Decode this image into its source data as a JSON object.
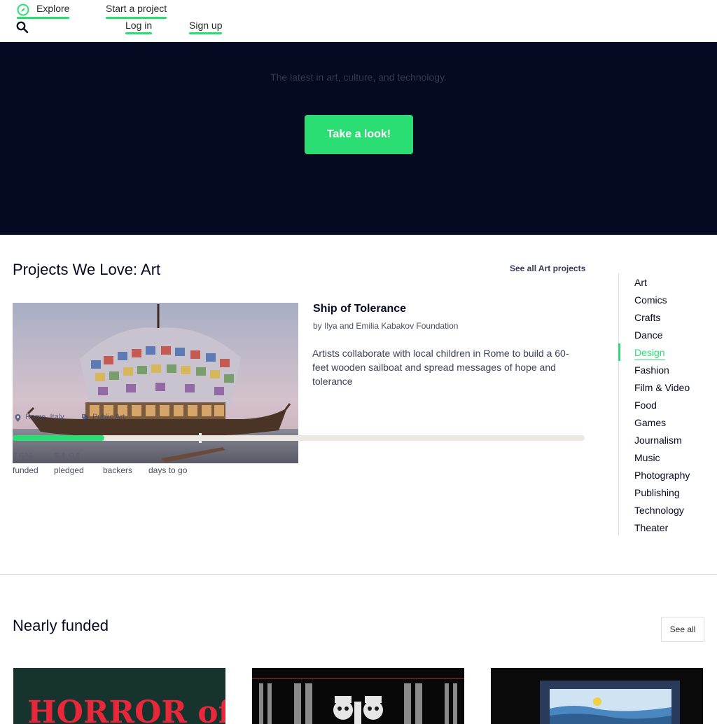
{
  "nav": {
    "explore": "Explore",
    "start_project": "Start a project",
    "log_in": "Log in",
    "sign_up": "Sign up",
    "search_icon": "search-icon",
    "explore_icon": "compass-icon"
  },
  "hero": {
    "tagline": "The latest in art, culture, and technology.",
    "button_label": "Take a look!"
  },
  "projects_we_love": {
    "title": "Projects We Love: Art",
    "see_all": "See all Art projects",
    "project": {
      "title": "Ship of Tolerance",
      "creator": "by Ilya and Emilia Kabakov Foundation",
      "blurb": "Artists collaborate with local children in Rome to build a 60-feet wooden sailboat and spread messages of hope and tolerance",
      "location": "Rome, Italy",
      "category": "Public Art",
      "funded_percent_label": "16%",
      "funded_fraction": 0.16,
      "pledged": "$4,94",
      "stat_labels": [
        "funded",
        "pledged",
        "backers",
        "days to go"
      ]
    }
  },
  "categories": {
    "items": [
      "Art",
      "Comics",
      "Crafts",
      "Dance",
      "Design",
      "Fashion",
      "Film & Video",
      "Food",
      "Games",
      "Journalism",
      "Music",
      "Photography",
      "Publishing",
      "Technology",
      "Theater"
    ],
    "active": "Design"
  },
  "nearly_funded": {
    "title": "Nearly funded",
    "see_all": "See all",
    "cards": [
      {
        "image_text": "HORROR of KHOR"
      },
      {
        "image_text": ""
      },
      {
        "image_text": ""
      }
    ]
  },
  "colors": {
    "accent": "#2bde73",
    "hero_bg": "#050a22",
    "text_dark": "#050a22"
  }
}
